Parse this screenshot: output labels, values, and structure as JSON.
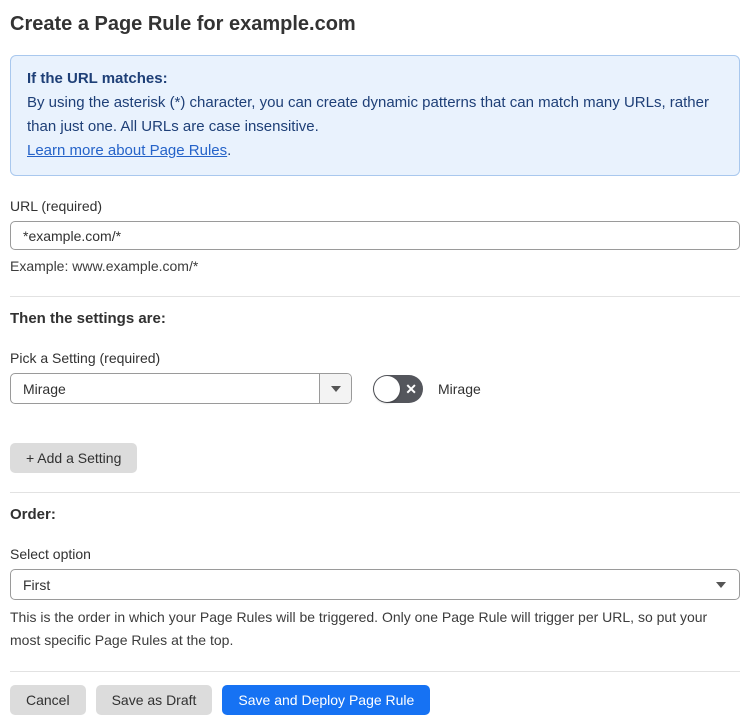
{
  "page": {
    "title": "Create a Page Rule for example.com"
  },
  "info_box": {
    "heading": "If the URL matches:",
    "body": "By using the asterisk (*) character, you can create dynamic patterns that can match many URLs, rather than just one. All URLs are case insensitive.",
    "link_label": "Learn more about Page Rules",
    "link_suffix": "."
  },
  "url_field": {
    "label": "URL (required)",
    "value": "*example.com/*",
    "helper": "Example: www.example.com/*"
  },
  "settings_section": {
    "heading": "Then the settings are:",
    "picker_label": "Pick a Setting (required)",
    "selected_setting": "Mirage",
    "toggle": {
      "state": "off",
      "glyph": "✕",
      "label": "Mirage"
    },
    "add_setting_label": "+ Add a Setting"
  },
  "order_section": {
    "heading": "Order:",
    "select_label": "Select option",
    "selected_option": "First",
    "helper": "This is the order in which your Page Rules will be triggered. Only one Page Rule will trigger per URL, so put your most specific Page Rules at the top."
  },
  "footer": {
    "cancel_label": "Cancel",
    "save_draft_label": "Save as Draft",
    "save_deploy_label": "Save and Deploy Page Rule"
  },
  "colors": {
    "accent_blue": "#1672f3",
    "info_bg": "#e9f2fd",
    "info_border": "#a9c8ee",
    "info_text": "#1e3f77",
    "link_blue": "#2563c9",
    "toggle_off_bg": "#54565c",
    "button_gray": "#dcdcdc"
  }
}
